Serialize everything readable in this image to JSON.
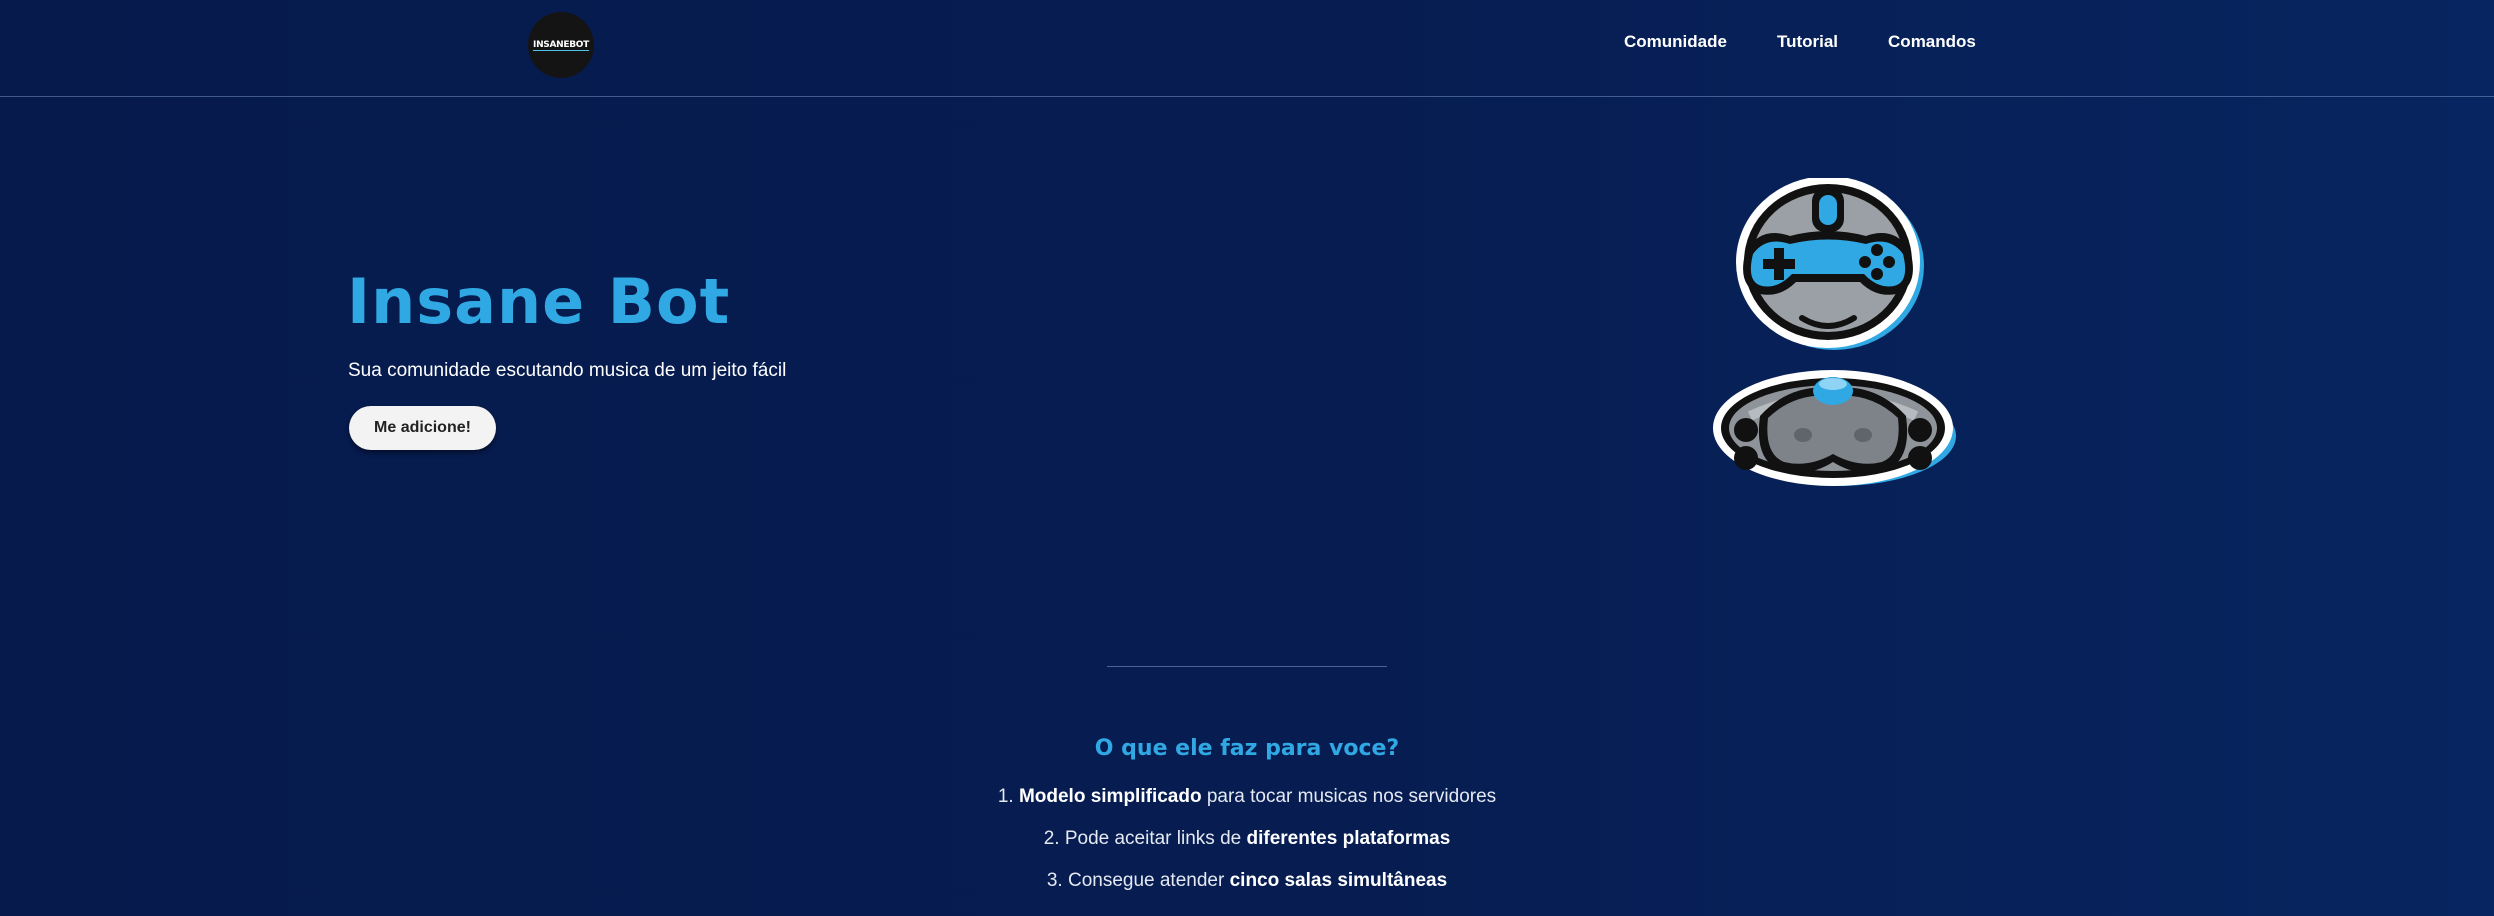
{
  "header": {
    "logo_text": "INSANEBOT",
    "nav": [
      "Comunidade",
      "Tutorial",
      "Comandos"
    ]
  },
  "hero": {
    "title": "Insane Bot",
    "subtitle": "Sua comunidade escutando musica de um jeito fácil",
    "cta_label": "Me adicione!"
  },
  "features": {
    "title": "O que ele faz para voce?",
    "items": [
      {
        "prefix": "1. ",
        "bold": "Modelo simplificado",
        "suffix": " para tocar musicas nos servidores"
      },
      {
        "prefix": "2. Pode aceitar links de ",
        "bold": "diferentes plataformas",
        "suffix": ""
      },
      {
        "prefix": "3. Consegue atender ",
        "bold": "cinco salas simultâneas",
        "suffix": ""
      }
    ]
  },
  "mascot": {
    "icon": "robot-gamer-mascot"
  },
  "colors": {
    "background": "#061a4c",
    "accent": "#2fa8e3",
    "button_bg": "#f3f3f3"
  }
}
